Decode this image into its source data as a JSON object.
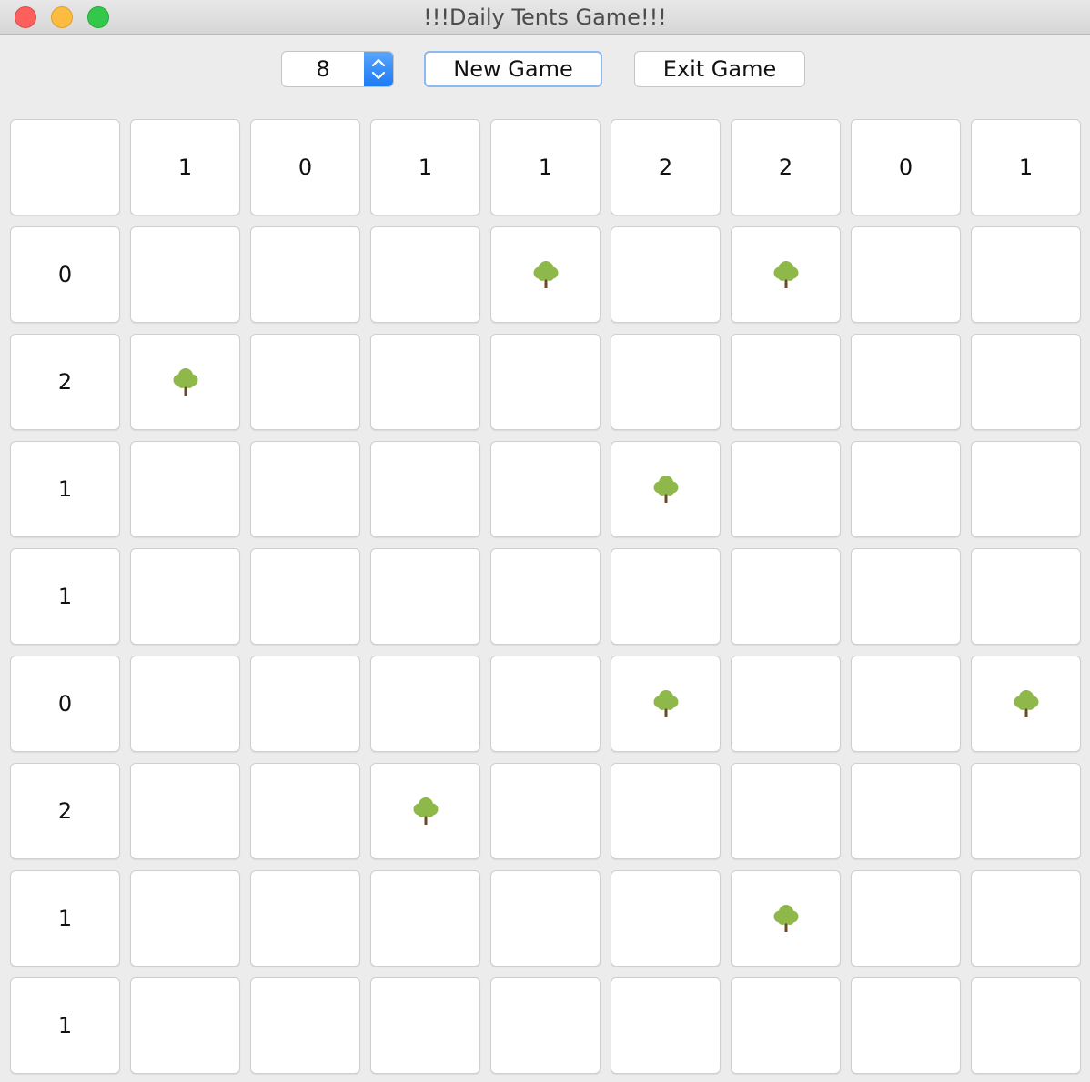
{
  "window": {
    "title": "!!!Daily Tents Game!!!"
  },
  "toolbar": {
    "size_value": "8",
    "new_game_label": "New Game",
    "exit_game_label": "Exit Game"
  },
  "board": {
    "size": 8,
    "column_clues": [
      "1",
      "0",
      "1",
      "1",
      "2",
      "2",
      "0",
      "1"
    ],
    "row_clues": [
      "0",
      "2",
      "1",
      "1",
      "0",
      "2",
      "1",
      "1"
    ],
    "grid": [
      [
        "",
        "",
        "",
        "tree",
        "",
        "tree",
        "",
        ""
      ],
      [
        "tree",
        "",
        "",
        "",
        "",
        "",
        "",
        ""
      ],
      [
        "",
        "",
        "",
        "",
        "tree",
        "",
        "",
        ""
      ],
      [
        "",
        "",
        "",
        "",
        "",
        "",
        "",
        ""
      ],
      [
        "",
        "",
        "",
        "",
        "tree",
        "",
        "",
        "tree"
      ],
      [
        "",
        "",
        "tree",
        "",
        "",
        "",
        "",
        ""
      ],
      [
        "",
        "",
        "",
        "",
        "",
        "tree",
        "",
        ""
      ],
      [
        "",
        "",
        "",
        "",
        "",
        "",
        "",
        ""
      ]
    ],
    "tree_icon": "tree-icon",
    "colors": {
      "tree_foliage": "#8fb84a",
      "tree_trunk": "#6b4a2b"
    }
  }
}
